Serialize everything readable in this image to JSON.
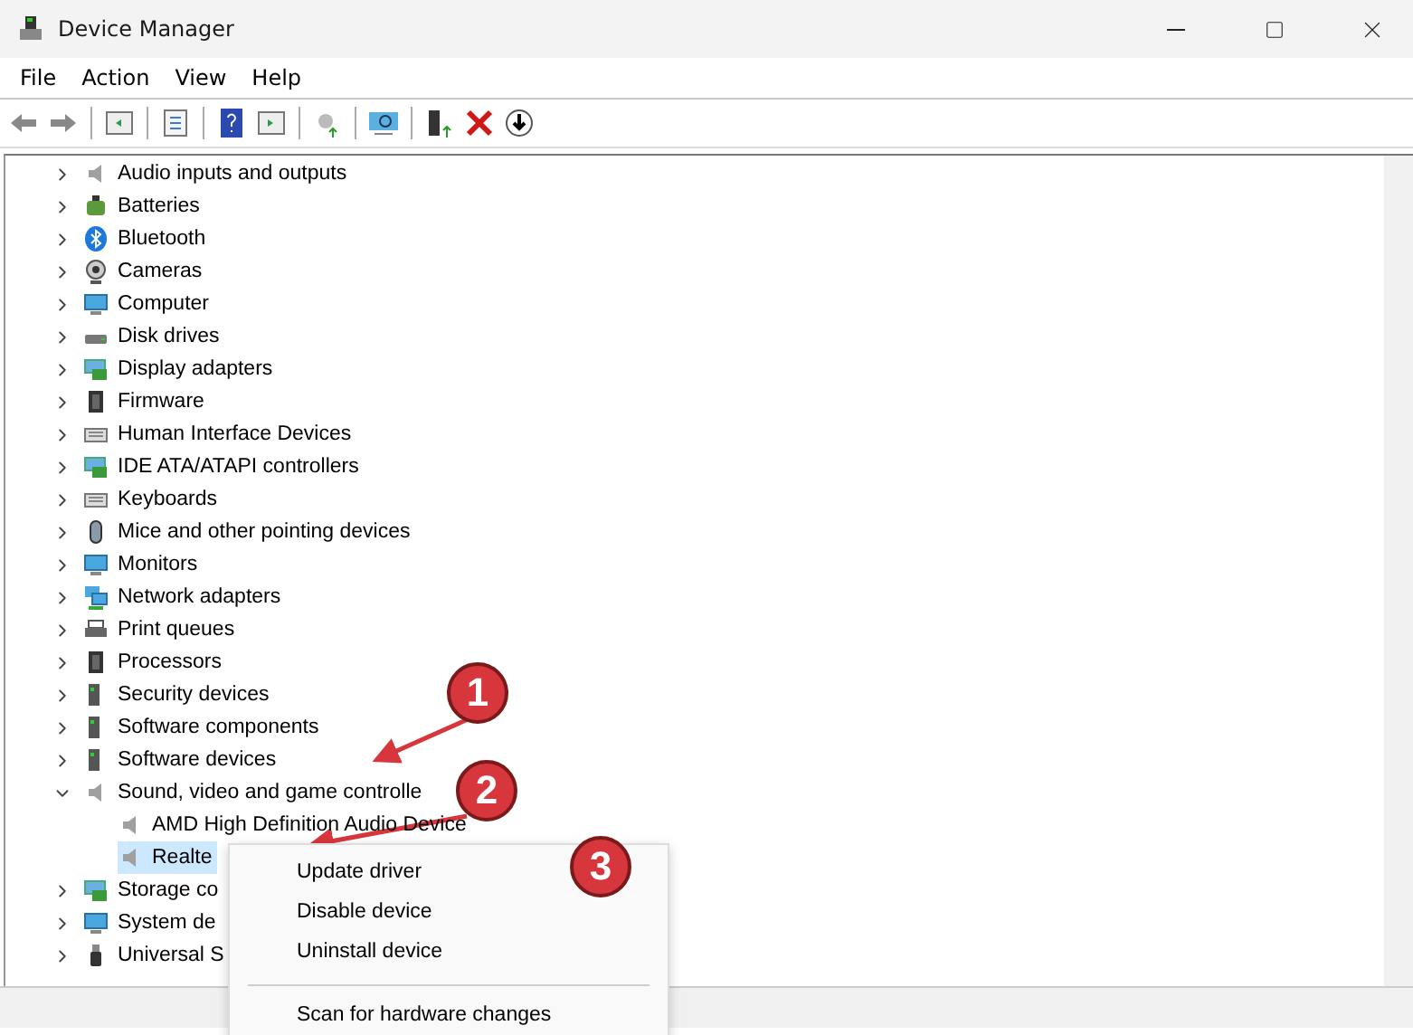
{
  "window": {
    "title": "Device Manager"
  },
  "menu": [
    "File",
    "Action",
    "View",
    "Help"
  ],
  "tree": [
    {
      "label": "Audio inputs and outputs",
      "kind": "speaker",
      "expanded": false,
      "selected": false
    },
    {
      "label": "Batteries",
      "kind": "battery",
      "expanded": false,
      "selected": false
    },
    {
      "label": "Bluetooth",
      "kind": "bluetooth",
      "expanded": false,
      "selected": false
    },
    {
      "label": "Cameras",
      "kind": "camera",
      "expanded": false,
      "selected": false
    },
    {
      "label": "Computer",
      "kind": "monitor",
      "expanded": false,
      "selected": false
    },
    {
      "label": "Disk drives",
      "kind": "disk",
      "expanded": false,
      "selected": false
    },
    {
      "label": "Display adapters",
      "kind": "adapter",
      "expanded": false,
      "selected": false
    },
    {
      "label": "Firmware",
      "kind": "chip",
      "expanded": false,
      "selected": false
    },
    {
      "label": "Human Interface Devices",
      "kind": "keyboard",
      "expanded": false,
      "selected": false
    },
    {
      "label": "IDE ATA/ATAPI controllers",
      "kind": "adapter",
      "expanded": false,
      "selected": false
    },
    {
      "label": "Keyboards",
      "kind": "keyboard",
      "expanded": false,
      "selected": false
    },
    {
      "label": "Mice and other pointing devices",
      "kind": "mouse",
      "expanded": false,
      "selected": false
    },
    {
      "label": "Monitors",
      "kind": "monitor",
      "expanded": false,
      "selected": false
    },
    {
      "label": "Network adapters",
      "kind": "network",
      "expanded": false,
      "selected": false
    },
    {
      "label": "Print queues",
      "kind": "printer",
      "expanded": false,
      "selected": false
    },
    {
      "label": "Processors",
      "kind": "chip",
      "expanded": false,
      "selected": false
    },
    {
      "label": "Security devices",
      "kind": "tower",
      "expanded": false,
      "selected": false
    },
    {
      "label": "Software components",
      "kind": "tower",
      "expanded": false,
      "selected": false
    },
    {
      "label": "Software devices",
      "kind": "tower",
      "expanded": false,
      "selected": false
    },
    {
      "label": "Sound, video and game controlle",
      "kind": "speaker",
      "expanded": true,
      "selected": false,
      "children": [
        {
          "label": "AMD High Definition Audio Device",
          "kind": "speaker",
          "selected": false
        },
        {
          "label": "Realte",
          "kind": "speaker",
          "selected": true
        }
      ]
    },
    {
      "label": "Storage co",
      "kind": "adapter",
      "expanded": false,
      "selected": false
    },
    {
      "label": "System de",
      "kind": "monitor",
      "expanded": false,
      "selected": false
    },
    {
      "label": "Universal S",
      "kind": "usb",
      "expanded": false,
      "selected": false
    }
  ],
  "context_menu": {
    "items": [
      "Update driver",
      "Disable device",
      "Uninstall device"
    ],
    "after_separator": [
      "Scan for hardware changes"
    ]
  },
  "annotations": [
    {
      "label": "1"
    },
    {
      "label": "2"
    },
    {
      "label": "3"
    }
  ]
}
